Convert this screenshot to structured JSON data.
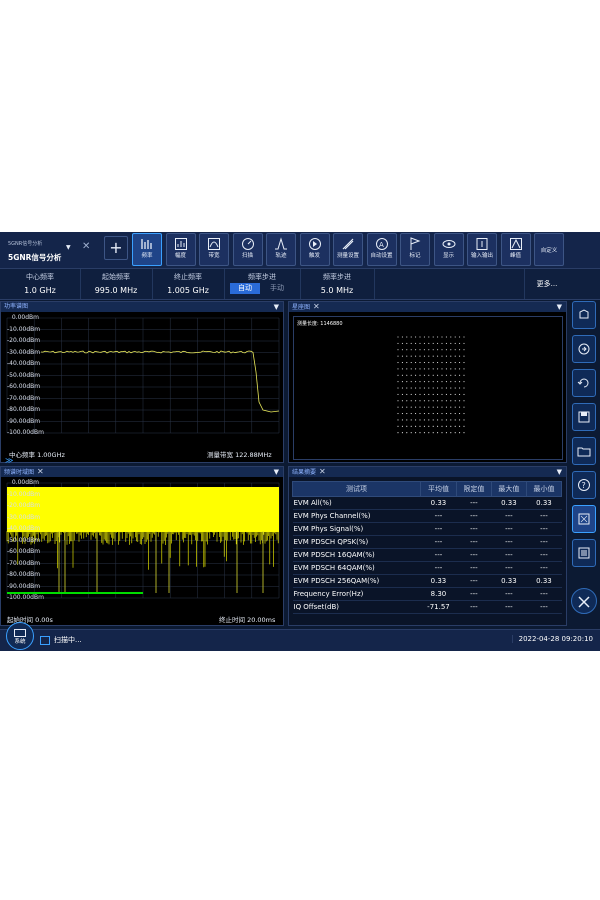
{
  "app": {
    "name_small": "5GNR信号分析",
    "name": "5GNR信号分析",
    "add_symbol": "+"
  },
  "toolbar": [
    {
      "label": "频率",
      "icon": "frequency-icon"
    },
    {
      "label": "幅度",
      "icon": "amplitude-icon"
    },
    {
      "label": "带宽",
      "icon": "bandwidth-icon"
    },
    {
      "label": "扫描",
      "icon": "sweep-icon"
    },
    {
      "label": "轨迹",
      "icon": "trace-icon"
    },
    {
      "label": "触发",
      "icon": "trigger-icon"
    },
    {
      "label": "测量设置",
      "icon": "meas-setup-icon"
    },
    {
      "label": "自动设置",
      "icon": "auto-setup-icon"
    },
    {
      "label": "标记",
      "icon": "marker-icon"
    },
    {
      "label": "显示",
      "icon": "display-icon"
    },
    {
      "label": "输入输出",
      "icon": "input-output-icon"
    },
    {
      "label": "峰值",
      "icon": "peak-icon"
    }
  ],
  "toolbar_custom": "自定义",
  "params": {
    "center": {
      "label": "中心频率",
      "value": "1.0 GHz"
    },
    "start": {
      "label": "起始频率",
      "value": "995.0 MHz"
    },
    "stop": {
      "label": "终止频率",
      "value": "1.005 GHz"
    },
    "step_mode": {
      "label": "频率步进",
      "auto": "自动",
      "manual": "手动"
    },
    "step": {
      "label": "频率步进",
      "value": "5.0 MHz"
    },
    "more": "更多..."
  },
  "spectrum": {
    "title": "功率谱图",
    "y_labels": [
      "0.00dBm",
      "-10.00dBm",
      "-20.00dBm",
      "-30.00dBm",
      "-40.00dBm",
      "-50.00dBm",
      "-60.00dBm",
      "-70.00dBm",
      "-80.00dBm",
      "-90.00dBm",
      "-100.00dBm"
    ],
    "center_text": "中心频率 1.00GHz",
    "span_text": "测量带宽 122.88MHz",
    "trace_color": "#e8e85a"
  },
  "constellation": {
    "title": "星座图",
    "label": "测量长度: 1146880"
  },
  "time_chart": {
    "title": "频谱时域图",
    "y_labels": [
      "0.00dBm",
      "-10.00dBm",
      "-20.00dBm",
      "-30.00dBm",
      "-40.00dBm",
      "-50.00dBm",
      "-60.00dBm",
      "-70.00dBm",
      "-80.00dBm",
      "-90.00dBm",
      "-100.00dBm"
    ],
    "start_time": "起始时间 0.00s",
    "stop_time": "终止时间 20.00ms",
    "fill_color": "#ffff00"
  },
  "results": {
    "title": "结果摘要",
    "headers": [
      "测试项",
      "平均值",
      "限定值",
      "最大值",
      "最小值"
    ],
    "rows": [
      [
        "EVM All(%)",
        "0.33",
        "---",
        "0.33",
        "0.33"
      ],
      [
        "EVM Phys Channel(%)",
        "---",
        "---",
        "---",
        "---"
      ],
      [
        "EVM Phys Signal(%)",
        "---",
        "---",
        "---",
        "---"
      ],
      [
        "EVM PDSCH QPSK(%)",
        "---",
        "---",
        "---",
        "---"
      ],
      [
        "EVM PDSCH 16QAM(%)",
        "---",
        "---",
        "---",
        "---"
      ],
      [
        "EVM PDSCH 64QAM(%)",
        "---",
        "---",
        "---",
        "---"
      ],
      [
        "EVM PDSCH 256QAM(%)",
        "0.33",
        "---",
        "0.33",
        "0.33"
      ],
      [
        "Frequency Error(Hz)",
        "8.30",
        "---",
        "---",
        "---"
      ],
      [
        "IQ Offset(dB)",
        "-71.57",
        "---",
        "---",
        "---"
      ]
    ]
  },
  "sidebar": [
    "save-trace-icon",
    "recall-icon",
    "refresh-icon",
    "save-icon",
    "folder-icon",
    "help-icon",
    "screenshot-icon",
    "export-icon",
    "tools-icon"
  ],
  "status": {
    "system": "系统",
    "message": "扫描中...",
    "datetime": "2022-04-28 09:20:10"
  },
  "colors": {
    "accent": "#3aa0ff",
    "background": "#0c1a33",
    "trace_green": "#00dd00"
  }
}
